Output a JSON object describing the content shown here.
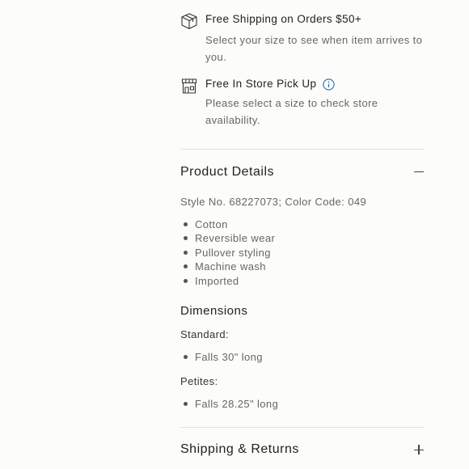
{
  "shipping": {
    "icon": "box-icon",
    "title": "Free Shipping on Orders $50+",
    "subtitle": "Select your size to see when item arrives to you."
  },
  "pickup": {
    "icon": "store-icon",
    "title": "Free In Store Pick Up",
    "info_icon": "info-icon",
    "subtitle": "Please select a size to check store availability."
  },
  "product_details": {
    "title": "Product Details",
    "toggle_icon": "minus-icon",
    "style_line": "Style No. 68227073; Color Code: 049",
    "features": [
      "Cotton",
      "Reversible wear",
      "Pullover styling",
      "Machine wash",
      "Imported"
    ],
    "dimensions": {
      "title": "Dimensions",
      "standard_label": "Standard:",
      "standard_items": [
        "Falls 30\" long"
      ],
      "petites_label": "Petites:",
      "petites_items": [
        "Falls 28.25\" long"
      ]
    }
  },
  "shipping_returns": {
    "title": "Shipping & Returns",
    "toggle_icon": "plus-icon"
  },
  "colors": {
    "accent_info": "#2a6fa8",
    "divider": "#e2e2de",
    "background": "#fcfcfa"
  }
}
